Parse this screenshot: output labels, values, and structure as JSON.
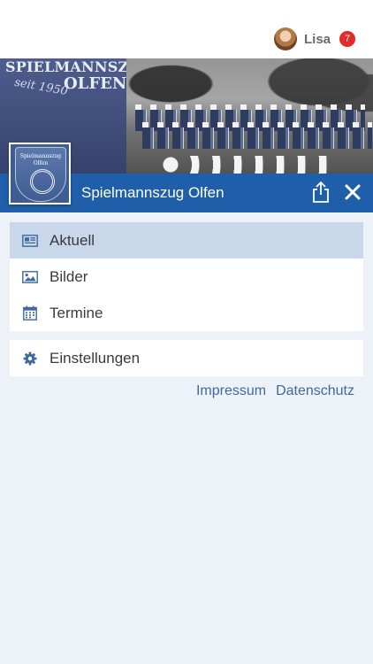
{
  "user": {
    "name": "Lisa",
    "notification_count": "7"
  },
  "banner": {
    "name_line1": "SPIELMANNSZUG",
    "since": "seit 1950",
    "name_line2": "OLFEN",
    "emblem_line1": "Spielmannszug",
    "emblem_line2": "Olfen"
  },
  "header": {
    "title": "Spielmannszug Olfen"
  },
  "menu": {
    "primary": [
      {
        "label": "Aktuell",
        "icon": "newspaper-icon",
        "active": true
      },
      {
        "label": "Bilder",
        "icon": "image-icon",
        "active": false
      },
      {
        "label": "Termine",
        "icon": "calendar-icon",
        "active": false
      }
    ],
    "secondary": [
      {
        "label": "Einstellungen",
        "icon": "gear-icon",
        "active": false
      }
    ]
  },
  "footer": {
    "impressum": "Impressum",
    "datenschutz": "Datenschutz"
  },
  "colors": {
    "header_bg": "#1f5fa9",
    "active_item_bg": "#c9d7ea",
    "icon_blue": "#3f6a9d",
    "badge": "#e32b27",
    "page_bg": "#edf1f8"
  }
}
